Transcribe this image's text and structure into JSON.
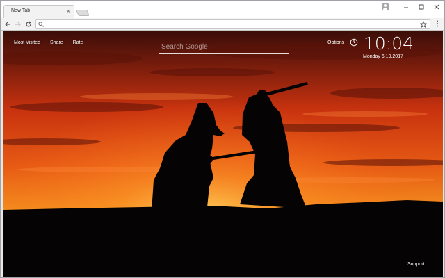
{
  "tab": {
    "title": "New Tab",
    "close_glyph": "×"
  },
  "window_controls": {
    "minimize_glyph": "–",
    "restore_glyph": "☐",
    "close_glyph": "×"
  },
  "omnibox": {
    "value": "",
    "placeholder": ""
  },
  "ntp": {
    "links": [
      "Most Visited",
      "Share",
      "Rate"
    ],
    "search_placeholder": "Search Google",
    "options_label": "Options",
    "time": "10:04",
    "date": "Monday  6.19.2017",
    "support_label": "Support"
  },
  "icons": {
    "back": "back-arrow-icon",
    "forward": "forward-arrow-icon",
    "reload": "reload-icon",
    "search": "search-icon",
    "bookmark": "star-icon",
    "menu": "three-dot-menu-icon",
    "profile": "profile-icon",
    "clock": "clock-icon"
  },
  "colors": {
    "sky_top": "#3a0d08",
    "sky_mid": "#c8320f",
    "sky_glow": "#f28a1d",
    "horizon": "#ffd85a",
    "silhouette": "#050303"
  }
}
